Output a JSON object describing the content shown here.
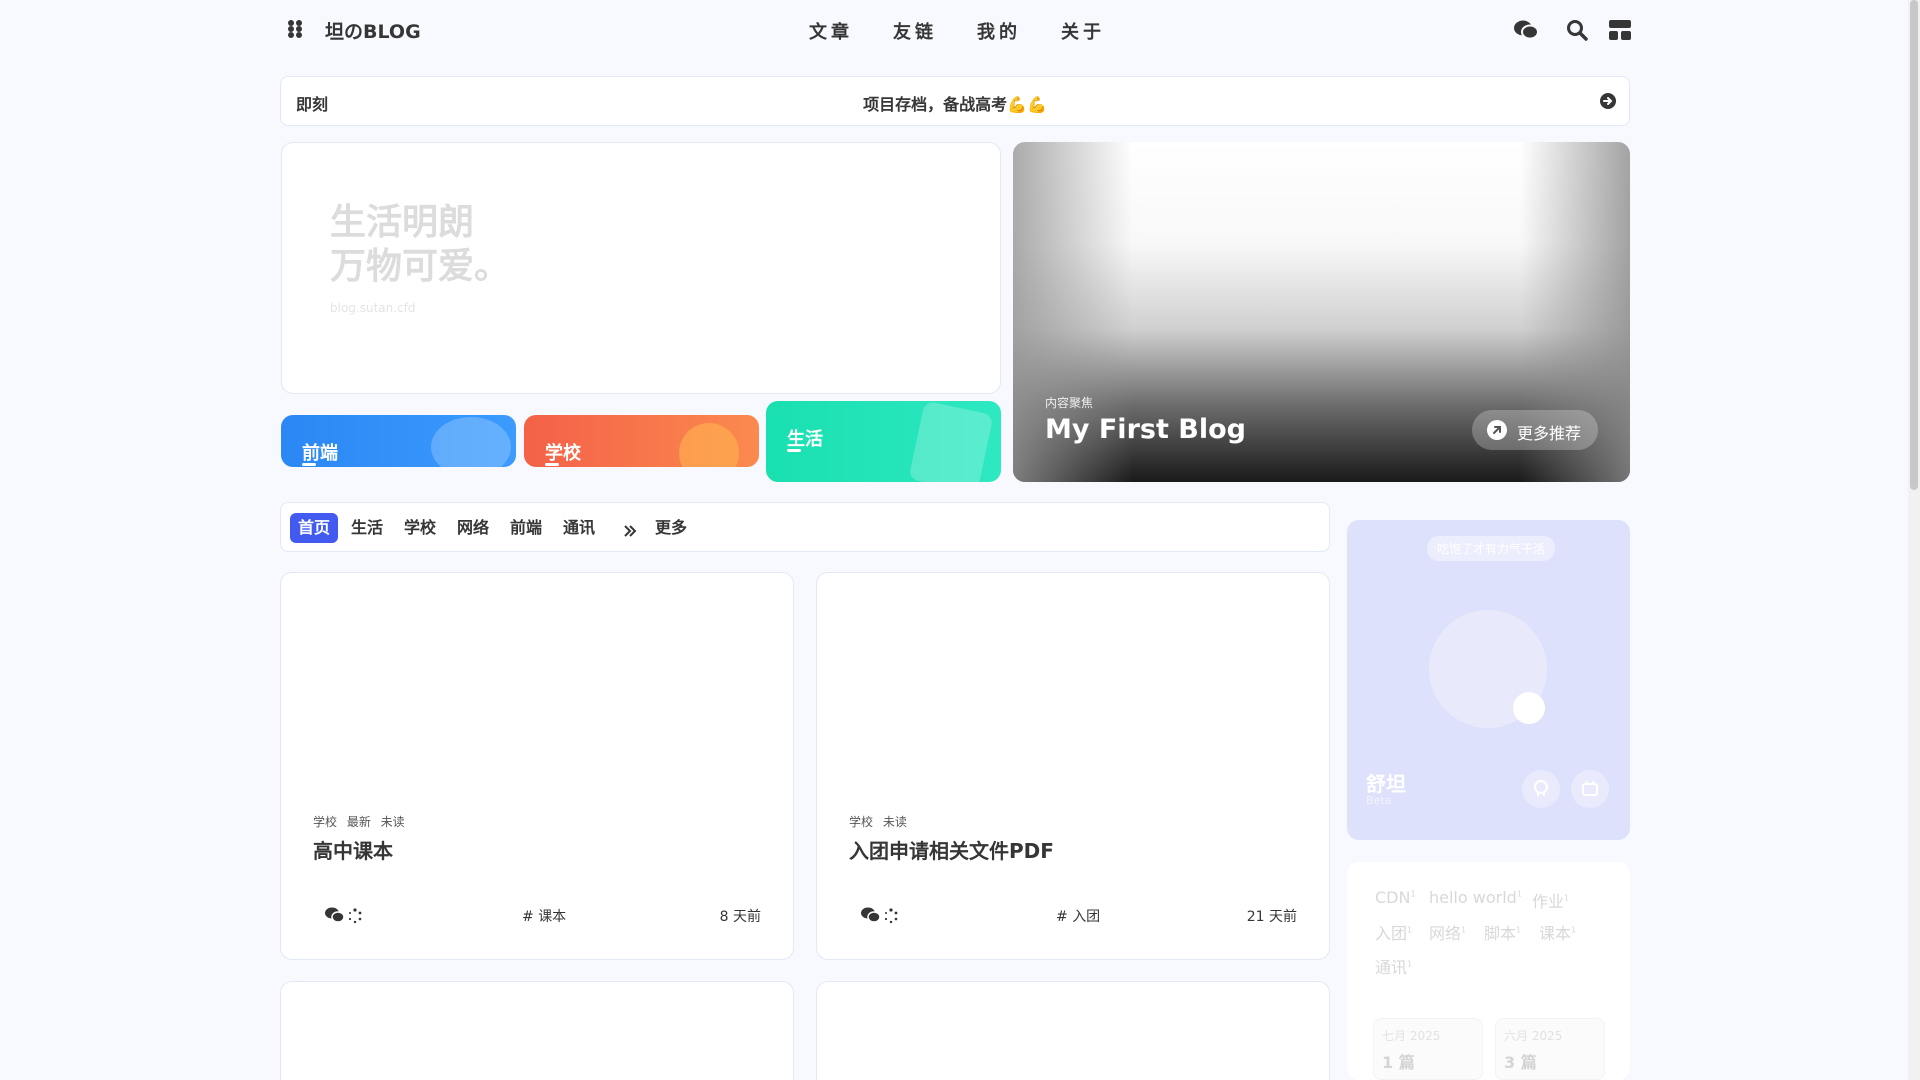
{
  "site": {
    "title": "坦のBLOG"
  },
  "nav": {
    "items": [
      "文章",
      "友链",
      "我的",
      "关于"
    ]
  },
  "announcement": {
    "label": "即刻",
    "text": "项目存档，备战高考💪💪"
  },
  "hero": {
    "slogan_line1": "生活明朗",
    "slogan_line2": "万物可爱。",
    "url": "blog.sutan.cfd",
    "categories": [
      {
        "label": "前端",
        "color": "#2b87f3"
      },
      {
        "label": "学校",
        "color": "#f7724a"
      },
      {
        "label": "生活",
        "color": "#1ce2b4"
      }
    ]
  },
  "feature": {
    "tag": "内容聚焦",
    "title": "My First Blog",
    "more_label": "更多推荐"
  },
  "tabs": {
    "items": [
      "首页",
      "生活",
      "学校",
      "网络",
      "前端",
      "通讯"
    ],
    "more_label": "更多",
    "active_color": "#425aef"
  },
  "posts": [
    {
      "tags": "学校 最新 未读",
      "title": "高中课本",
      "tag": "课本",
      "date": "8 天前"
    },
    {
      "tags": "学校 未读",
      "title": "入团申请相关文件PDF",
      "tag": "入团",
      "date": "21 天前"
    }
  ],
  "author": {
    "greeting": "吃饱了才有力气干活",
    "name": "舒坦",
    "sub": "Beta"
  },
  "tagcloud": {
    "row1": [
      "CDN",
      "hello world",
      "作业"
    ],
    "row2": [
      "入团",
      "网络",
      "脚本",
      "课本"
    ],
    "row3": [
      "通讯"
    ],
    "sup": "1"
  },
  "archives": [
    {
      "month": "七月 2025",
      "count": "1 篇"
    },
    {
      "month": "六月 2025",
      "count": "3 篇"
    }
  ]
}
